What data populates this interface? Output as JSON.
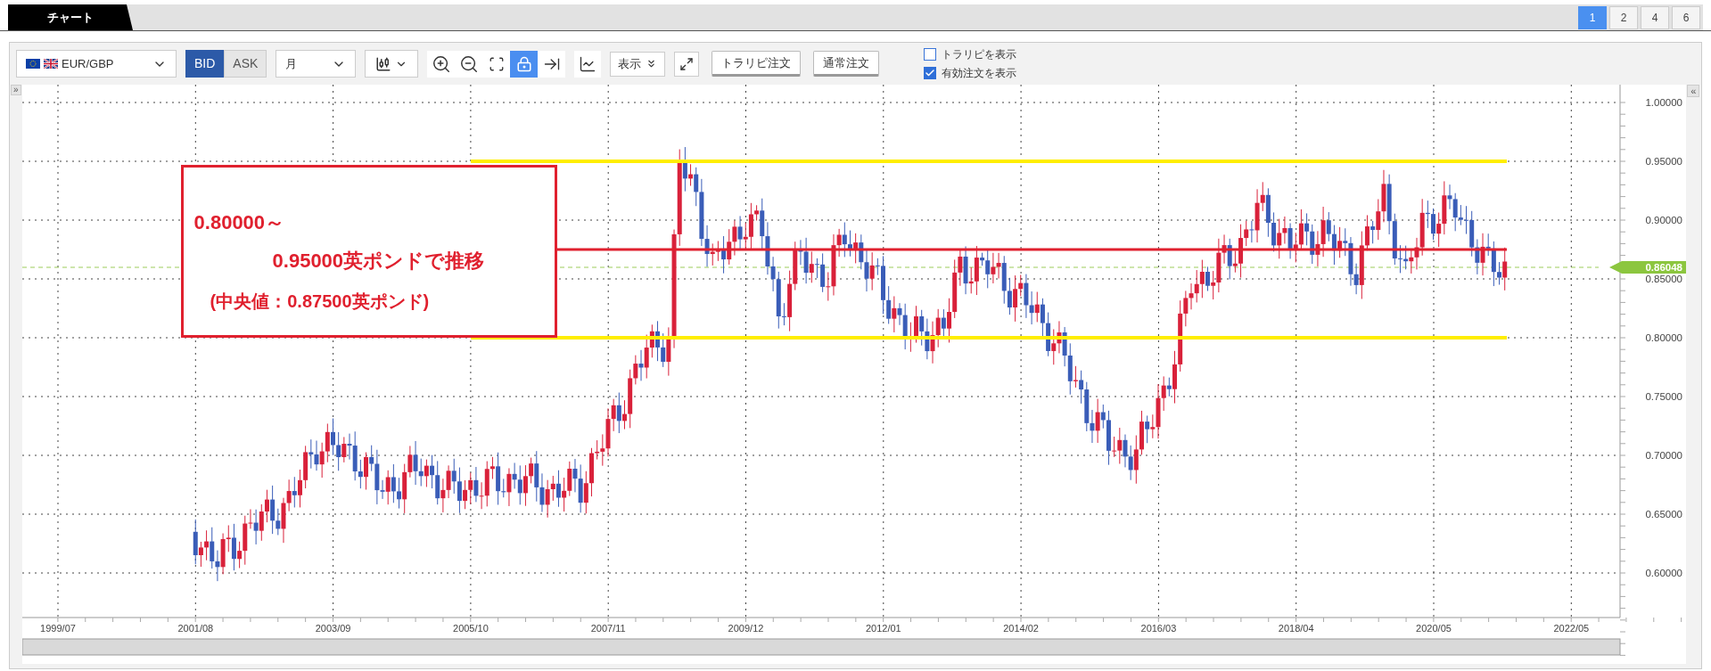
{
  "tabs": [
    {
      "label": "チャート",
      "selected": true
    }
  ],
  "pages": [
    {
      "label": "1",
      "selected": true
    },
    {
      "label": "2",
      "selected": false
    },
    {
      "label": "4",
      "selected": false
    },
    {
      "label": "6",
      "selected": false
    }
  ],
  "toolbar": {
    "symbol": "EUR/GBP",
    "price_side": [
      {
        "label": "BID",
        "selected": true
      },
      {
        "label": "ASK",
        "selected": false
      }
    ],
    "period": "月",
    "tools": [
      {
        "kind": "zoom-in",
        "on": false
      },
      {
        "kind": "zoom-out",
        "on": false
      },
      {
        "kind": "fit",
        "on": false
      },
      {
        "kind": "y-lock",
        "on": true
      },
      {
        "kind": "to-end",
        "on": false
      }
    ],
    "display_menu": "表示",
    "order_buttons": [
      "トラリピ注文",
      "通常注文"
    ],
    "checkboxes": [
      {
        "label": "トラリピを表示",
        "checked": false
      },
      {
        "label": "有効注文を表示",
        "checked": true
      }
    ]
  },
  "chart": {
    "collapse_left": "»",
    "collapse_right": "«",
    "y_ticks": [
      "1.00000",
      "0.95000",
      "0.90000",
      "0.85000",
      "0.80000",
      "0.75000",
      "0.70000",
      "0.65000",
      "0.60000"
    ],
    "x_ticks": [
      "1999/07",
      "2001/08",
      "2003/09",
      "2005/10",
      "2007/11",
      "2009/12",
      "2012/01",
      "2014/02",
      "2016/03",
      "2018/04",
      "2020/05",
      "2022/05"
    ],
    "current_price": "0.86048",
    "annotation": [
      "0.80000～",
      "0.95000英ポンドで推移",
      "(中央値：0.87500英ポンド)"
    ]
  }
}
